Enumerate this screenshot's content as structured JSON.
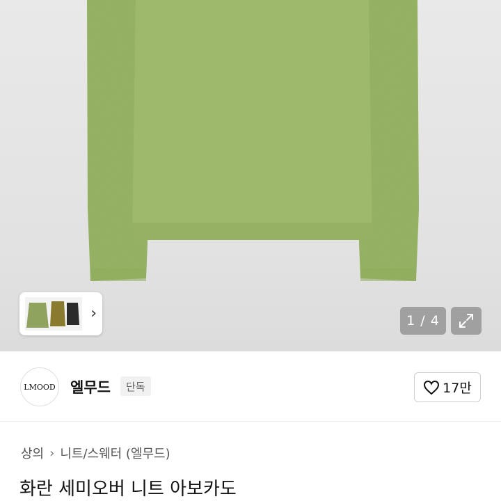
{
  "gallery": {
    "counter": "1 / 4",
    "thumbnail_colors": [
      "#8fa25e",
      "#8a7a2e",
      "#2b2b2b"
    ],
    "sweater_color": "#9fba6b"
  },
  "brand": {
    "logo_text": "LMOOD",
    "name": "엘무드",
    "badge": "단독",
    "like_count": "17만"
  },
  "breadcrumb": {
    "items": [
      "상의",
      "니트/스웨터 (엘무드)"
    ]
  },
  "product": {
    "title": "화란 세미오버 니트 아보카도"
  }
}
